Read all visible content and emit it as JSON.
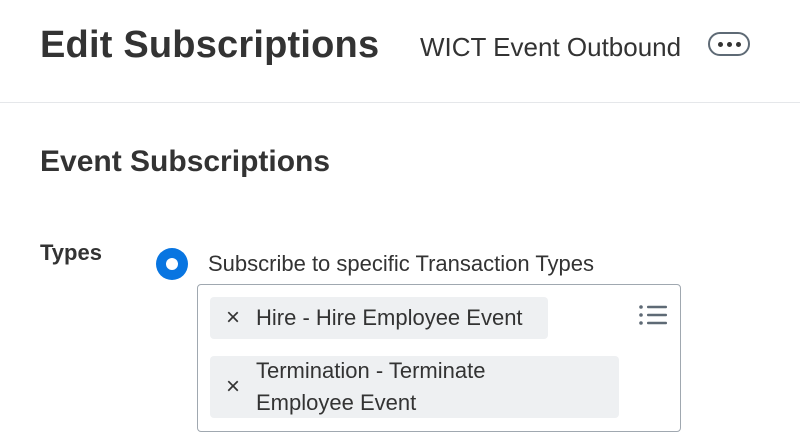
{
  "header": {
    "title": "Edit Subscriptions",
    "object_name": "WICT Event Outbound",
    "related_actions_icon": "more-horizontal-icon"
  },
  "section": {
    "title": "Event Subscriptions"
  },
  "types_field": {
    "label": "Types",
    "radio_option": {
      "label": "Subscribe to specific Transaction Types",
      "selected": true
    },
    "selected_items": [
      {
        "label": "Hire - Hire Employee Event",
        "remove_icon": "×"
      },
      {
        "label": "Termination - Terminate Employee Event",
        "remove_icon": "×"
      }
    ],
    "prompt_icon": "list-icon"
  },
  "colors": {
    "accent": "#0875e1",
    "text": "#333333",
    "pill_bg": "#eef0f2",
    "border": "#a0a8b0"
  }
}
